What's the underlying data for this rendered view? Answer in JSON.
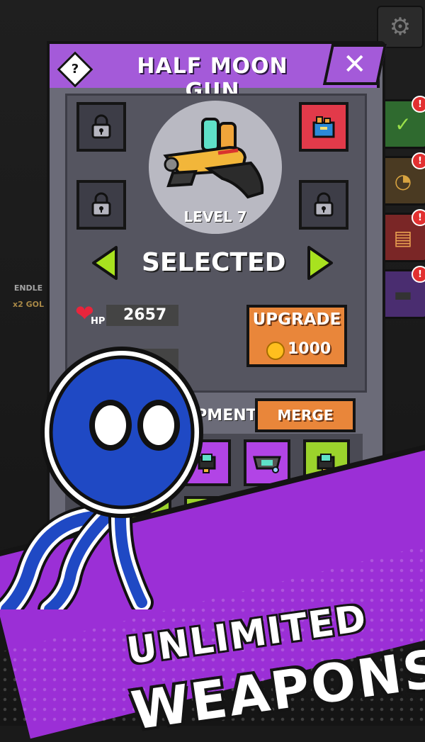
{
  "screen": {
    "title": "HALF MOON GUN",
    "help_symbol": "?",
    "close_symbol": "✕",
    "settings_icon": "gear-icon"
  },
  "weapon": {
    "level_label": "LEVEL 7",
    "status": "SELECTED",
    "hp_label": "HP",
    "hp_value": "2657"
  },
  "upgrade": {
    "label": "UPGRADE",
    "cost": "1000"
  },
  "equipment": {
    "label": "IPMENT",
    "merge_label": "MERGE"
  },
  "side": {
    "endless_line1": "ENDLE",
    "endless_line2": "x2 GOL",
    "badge": "!"
  },
  "banner": {
    "line1": "UNLIMITED",
    "line2": "WEAPONS!"
  },
  "colors": {
    "header": "#a45ad9",
    "upgrade": "#e9863a",
    "arrow": "#a8e21f",
    "banner": "#9b2fd6",
    "stickman": "#1f49c4"
  }
}
